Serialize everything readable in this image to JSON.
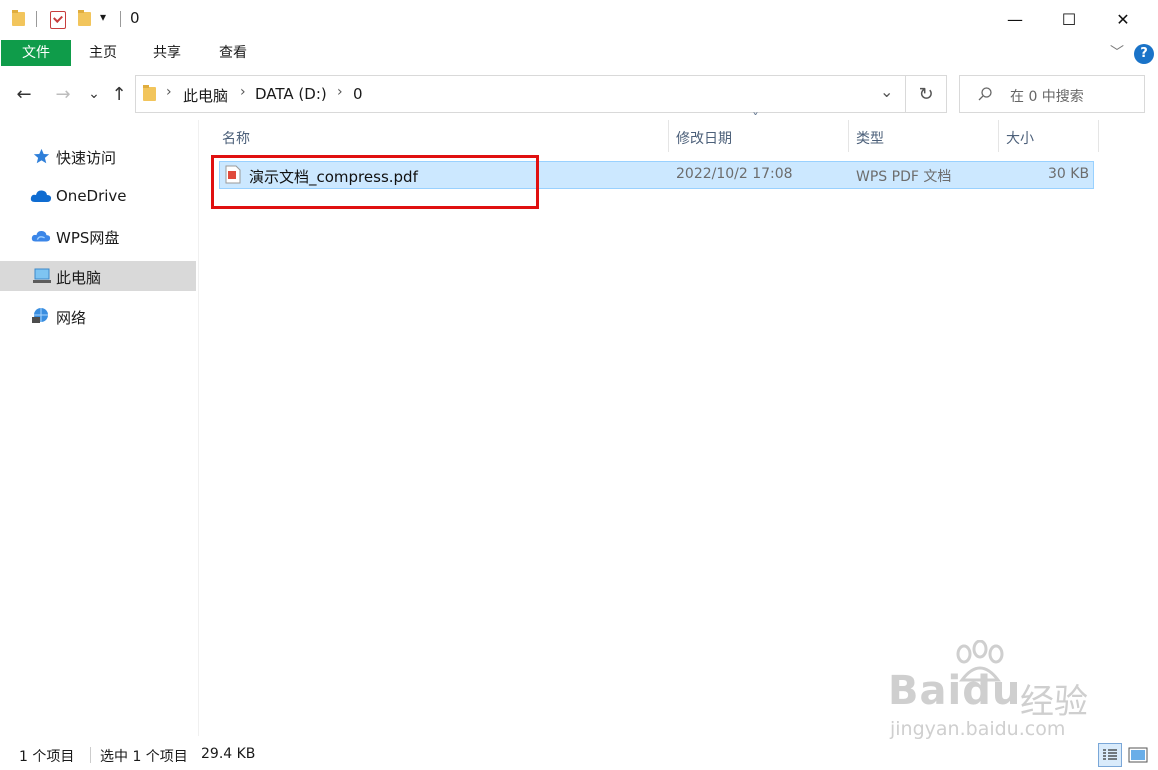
{
  "window": {
    "title": "0",
    "minimize_glyph": "—",
    "maximize_glyph": "☐",
    "close_glyph": "✕",
    "quick_access_dropdown": "▾"
  },
  "ribbon": {
    "tabs": [
      {
        "label": "文件",
        "active": true,
        "accent": "#0f9c4a"
      },
      {
        "label": "主页"
      },
      {
        "label": "共享"
      },
      {
        "label": "查看"
      }
    ],
    "expand_glyph": "﹀",
    "help_glyph": "?"
  },
  "address_bar": {
    "breadcrumbs": [
      "此电脑",
      "DATA (D:)",
      "0"
    ],
    "dropdown_glyph": "⌄",
    "refresh_glyph": "↻"
  },
  "nav_buttons": {
    "back": "←",
    "forward": "→",
    "recent": "⌄",
    "up": "↑"
  },
  "search": {
    "placeholder": "在 0 中搜索",
    "icon": "search-icon"
  },
  "nav_pane": {
    "items": [
      {
        "label": "快速访问",
        "icon": "star-icon",
        "selected": false
      },
      {
        "label": "OneDrive",
        "icon": "cloud-icon",
        "selected": false
      },
      {
        "label": "WPS网盘",
        "icon": "wps-cloud-icon",
        "selected": false
      },
      {
        "label": "此电脑",
        "icon": "computer-icon",
        "selected": true
      },
      {
        "label": "网络",
        "icon": "network-icon",
        "selected": false
      }
    ]
  },
  "file_list": {
    "columns": [
      "名称",
      "修改日期",
      "类型",
      "大小"
    ],
    "sort_glyph": "ˇ",
    "rows": [
      {
        "name": "演示文档_compress.pdf",
        "modified": "2022/10/2 17:08",
        "type": "WPS PDF 文档",
        "size": "30 KB",
        "selected": true,
        "icon": "pdf-file-icon"
      }
    ]
  },
  "status_bar": {
    "item_count": "1 个项目",
    "selection": "选中 1 个项目",
    "selection_size": "29.4 KB"
  },
  "watermark": {
    "brand": "Baidu",
    "suffix": "经验",
    "url": "jingyan.baidu.com"
  },
  "colors": {
    "accent_green": "#0f9c4a",
    "selection_fill": "#cce8ff",
    "highlight_red": "#e01010",
    "header_text": "#4c607a"
  }
}
